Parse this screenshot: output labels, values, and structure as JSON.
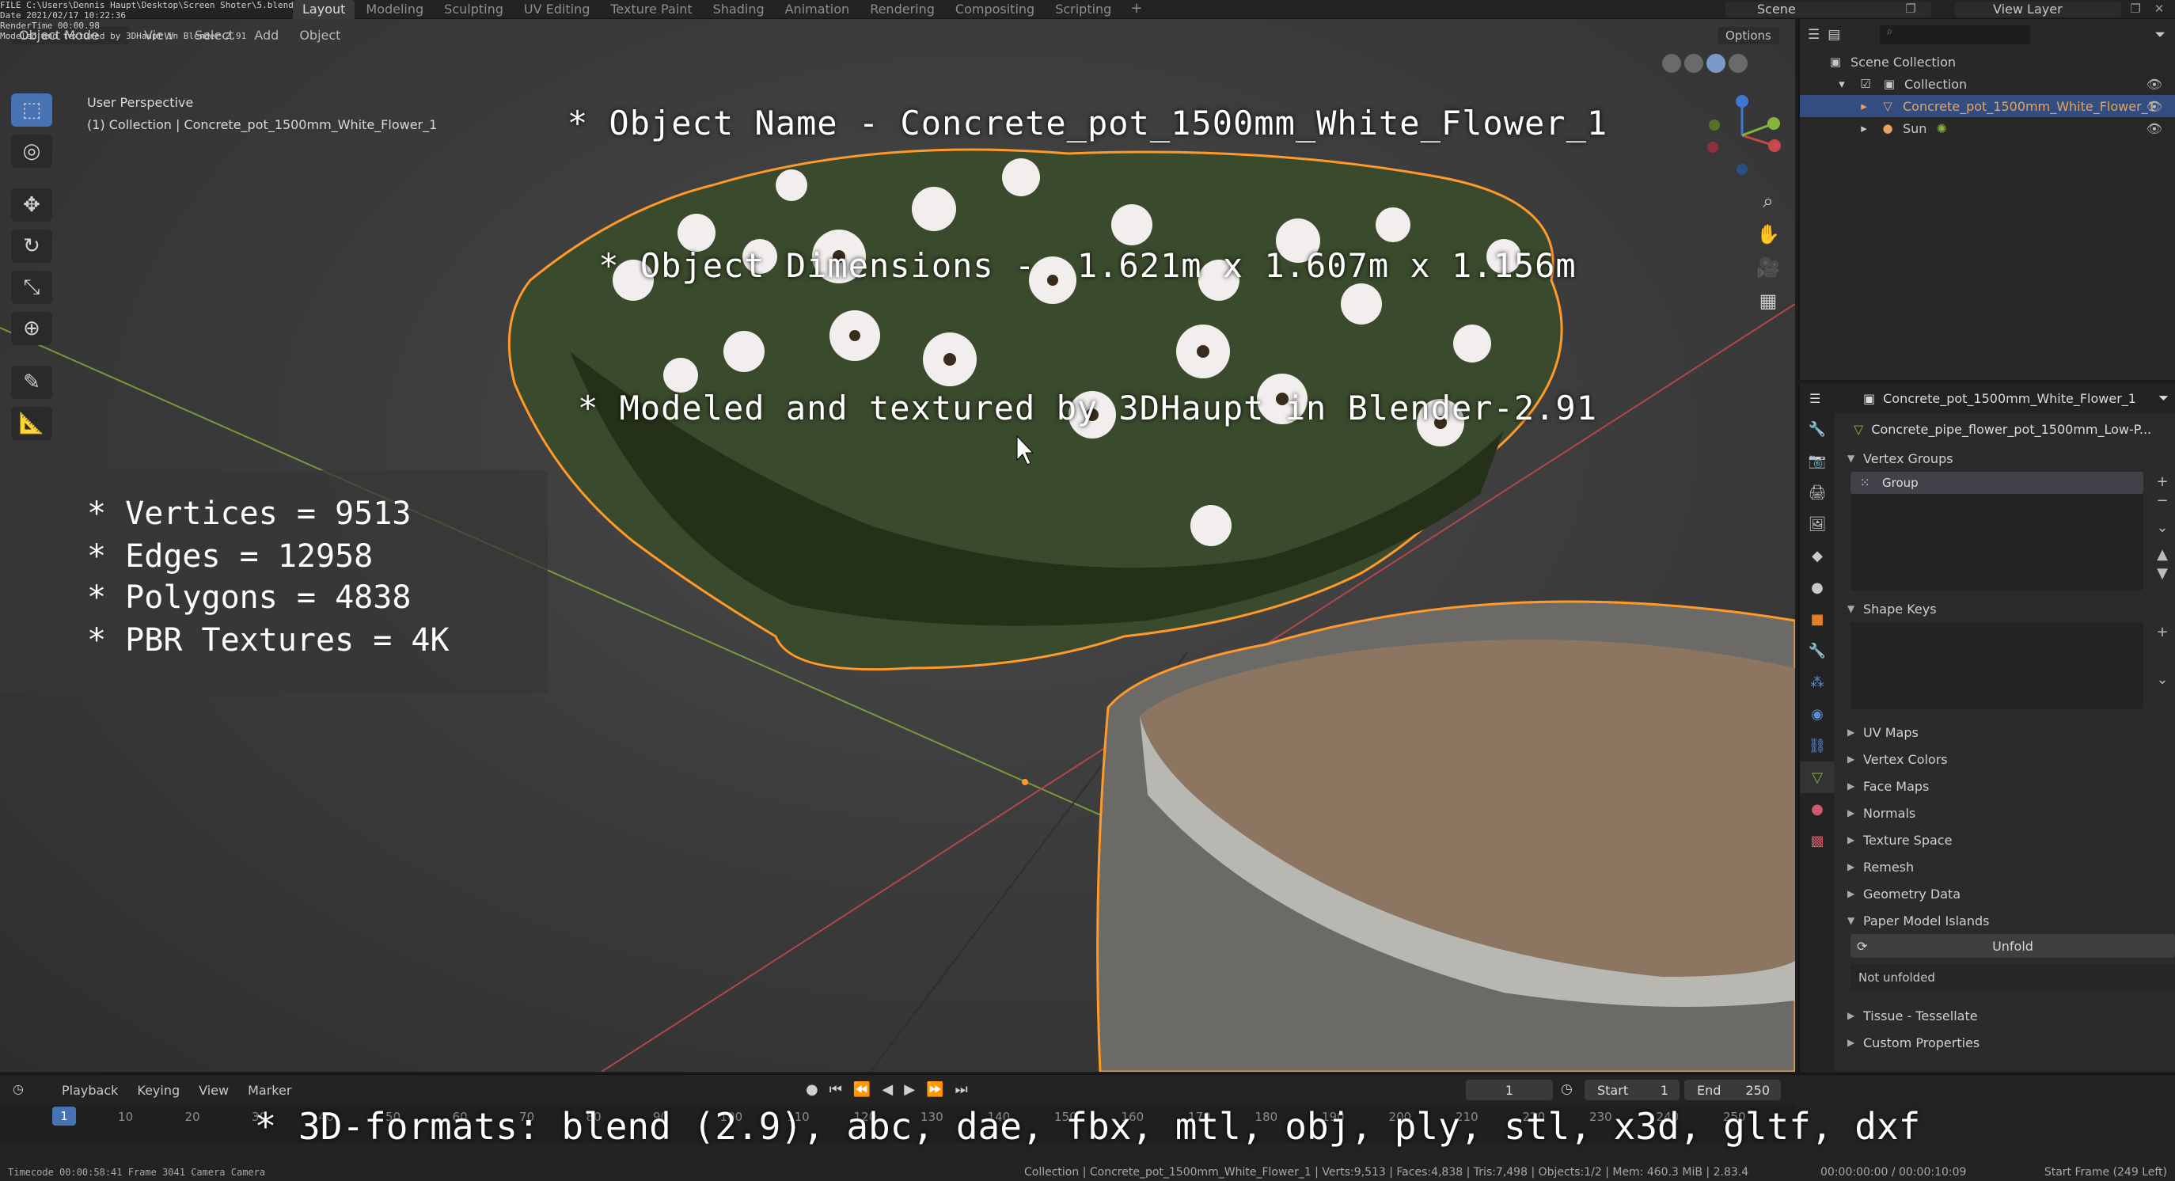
{
  "file_info": {
    "lines": [
      "FILE C:\\Users\\Dennis Haupt\\Desktop\\Screen Shoter\\5.blend",
      "Date 2021/02/17 10:22:36",
      "RenderTime 00:00.98",
      "Modeled and textured by 3DHaupt in Blender-2.91"
    ]
  },
  "workspace_tabs": [
    "Layout",
    "Modeling",
    "Sculpting",
    "UV Editing",
    "Texture Paint",
    "Shading",
    "Animation",
    "Rendering",
    "Compositing",
    "Scripting"
  ],
  "workspace_add": "+",
  "scene_label": "Scene",
  "view_layer_label": "View Layer",
  "viewport": {
    "mode": "Object Mode",
    "menus": [
      "View",
      "Select",
      "Add",
      "Object"
    ],
    "perspective": "User Perspective",
    "collection_info": "(1) Collection | Concrete_pot_1500mm_White_Flower_1",
    "options": "Options"
  },
  "overlay": {
    "title_lines": [
      "* Object Name - Concrete_pot_1500mm_White_Flower_1",
      "* Object Dimensions -  1.621m x 1.607m x 1.156m",
      "* Modeled and textured by 3DHaupt in Blender-2.91"
    ],
    "stats": [
      "* Vertices = 9513",
      "* Edges = 12958",
      "* Polygons = 4838",
      "* PBR Textures = 4K"
    ],
    "formats": "* 3D-formats: blend (2.9), abc, dae, fbx, mtl, obj, ply, stl, x3d, gltf, dxf"
  },
  "outliner": {
    "rows": [
      {
        "label": "Scene Collection",
        "icon": "scene-collection-icon",
        "indent": 0,
        "selected": false
      },
      {
        "label": "Collection",
        "icon": "collection-icon",
        "indent": 1,
        "selected": false
      },
      {
        "label": "Concrete_pot_1500mm_White_Flower_1",
        "icon": "mesh-object-icon",
        "indent": 2,
        "selected": true
      },
      {
        "label": "Sun",
        "icon": "light-icon",
        "indent": 2,
        "selected": false
      }
    ]
  },
  "properties": {
    "object_name": "Concrete_pot_1500mm_White_Flower_1",
    "mesh_name": "Concrete_pipe_flower_pot_1500mm_Low-P...",
    "vertex_groups": "Vertex Groups",
    "group_item": "Group",
    "shape_keys": "Shape Keys",
    "collapsed_panels": [
      "UV Maps",
      "Vertex Colors",
      "Face Maps",
      "Normals",
      "Texture Space",
      "Remesh",
      "Geometry Data"
    ],
    "paper_model": "Paper Model Islands",
    "unfold": "Unfold",
    "not_unfolded": "Not unfolded",
    "bottom_panels": [
      "Tissue - Tessellate",
      "Custom Properties"
    ]
  },
  "timeline": {
    "menus": [
      "Playback",
      "Keying",
      "View",
      "Marker"
    ],
    "current_frame": "1",
    "start_label": "Start",
    "start_value": "1",
    "end_label": "End",
    "end_value": "250",
    "ticks": [
      "10",
      "20",
      "30",
      "40",
      "50",
      "60",
      "70",
      "80",
      "90",
      "100",
      "110",
      "120",
      "130",
      "140",
      "150",
      "160",
      "170",
      "180",
      "190",
      "200",
      "210",
      "220",
      "230",
      "240",
      "250"
    ],
    "playhead": "1"
  },
  "statusbar": {
    "left": "Timecode 00:00:58:41   Frame 3041   Camera Camera",
    "middle": "Collection | Concrete_pot_1500mm_White_Flower_1 | Verts:9,513 | Faces:4,838 | Tris:7,498 | Objects:1/2 | Mem: 460.3 MiB | 2.83.4",
    "timecode": "00:00:00:00 / 00:00:10:09",
    "right": "Start Frame (249 Left)"
  },
  "colors": {
    "selection_outline": "#ff9a2a",
    "accent_blue": "#4772b3",
    "x_axis": "#c8484f",
    "y_axis": "#86b33a"
  }
}
